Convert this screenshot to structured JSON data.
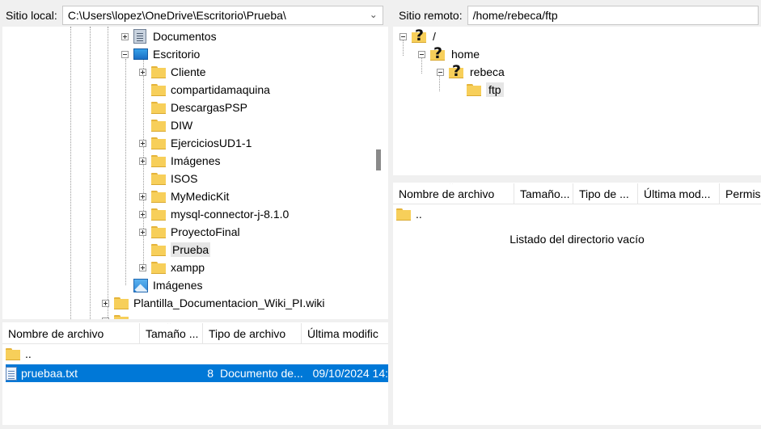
{
  "local": {
    "label": "Sitio local:",
    "path": "C:\\Users\\lopez\\OneDrive\\Escritorio\\Prueba\\",
    "tree": [
      {
        "label": "Documentos",
        "icon": "documents-icon"
      },
      {
        "label": "Escritorio",
        "icon": "desktop-icon"
      },
      {
        "label": "Cliente",
        "icon": "folder-icon"
      },
      {
        "label": "compartidamaquina",
        "icon": "folder-icon"
      },
      {
        "label": "DescargasPSP",
        "icon": "folder-icon"
      },
      {
        "label": "DIW",
        "icon": "folder-icon"
      },
      {
        "label": "EjerciciosUD1-1",
        "icon": "folder-icon"
      },
      {
        "label": "Imágenes",
        "icon": "folder-icon"
      },
      {
        "label": "ISOS",
        "icon": "folder-icon"
      },
      {
        "label": "MyMedicKit",
        "icon": "folder-icon"
      },
      {
        "label": "mysql-connector-j-8.1.0",
        "icon": "folder-icon"
      },
      {
        "label": "ProyectoFinal",
        "icon": "folder-icon"
      },
      {
        "label": "Prueba",
        "icon": "folder-icon"
      },
      {
        "label": "xampp",
        "icon": "folder-icon"
      },
      {
        "label": "Imágenes",
        "icon": "pictures-icon"
      },
      {
        "label": "Plantilla_Documentacion_Wiki_PI.wiki",
        "icon": "folder-icon"
      }
    ],
    "columns": [
      "Nombre de archivo",
      "Tamaño ...",
      "Tipo de archivo",
      "Última modific"
    ],
    "files": [
      {
        "name": "..",
        "size": "",
        "type": "",
        "modified": ""
      },
      {
        "name": "pruebaa.txt",
        "size": "8",
        "type": "Documento de...",
        "modified": "09/10/2024 14:"
      }
    ]
  },
  "remote": {
    "label": "Sitio remoto:",
    "path": "/home/rebeca/ftp",
    "tree": [
      {
        "label": "/",
        "icon": "unknown-folder-icon"
      },
      {
        "label": "home",
        "icon": "unknown-folder-icon"
      },
      {
        "label": "rebeca",
        "icon": "unknown-folder-icon"
      },
      {
        "label": "ftp",
        "icon": "folder-icon"
      }
    ],
    "columns": [
      "Nombre de archivo",
      "Tamaño...",
      "Tipo de ...",
      "Última mod...",
      "Permis"
    ],
    "files": [
      {
        "name": ".."
      }
    ],
    "empty_message": "Listado del directorio vacío"
  },
  "colors": {
    "selection": "#0078d7",
    "folder": "#f7cf5a"
  }
}
